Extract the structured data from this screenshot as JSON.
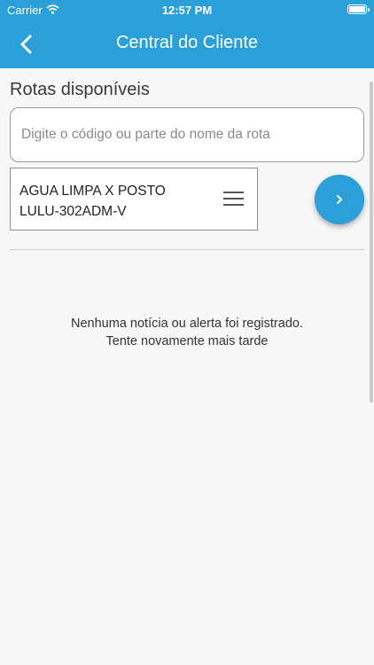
{
  "status_bar": {
    "carrier": "Carrier",
    "time": "12:57 PM"
  },
  "header": {
    "title": "Central do Cliente",
    "back_icon": "chevron-left-icon"
  },
  "routes": {
    "section_title": "Rotas disponíveis",
    "search_placeholder": "Digite o código ou parte do nome da rota",
    "selected_route_line1": "AGUA LIMPA X POSTO",
    "selected_route_line2": "LULU-302ADM-V",
    "menu_icon": "menu-icon",
    "next_icon": "chevron-right-icon"
  },
  "empty_state": {
    "line1": "Nenhuma notícia ou alerta foi registrado.",
    "line2": "Tente novamente mais tarde"
  },
  "colors": {
    "accent": "#2a9fd8",
    "background": "#f7f7f7"
  }
}
